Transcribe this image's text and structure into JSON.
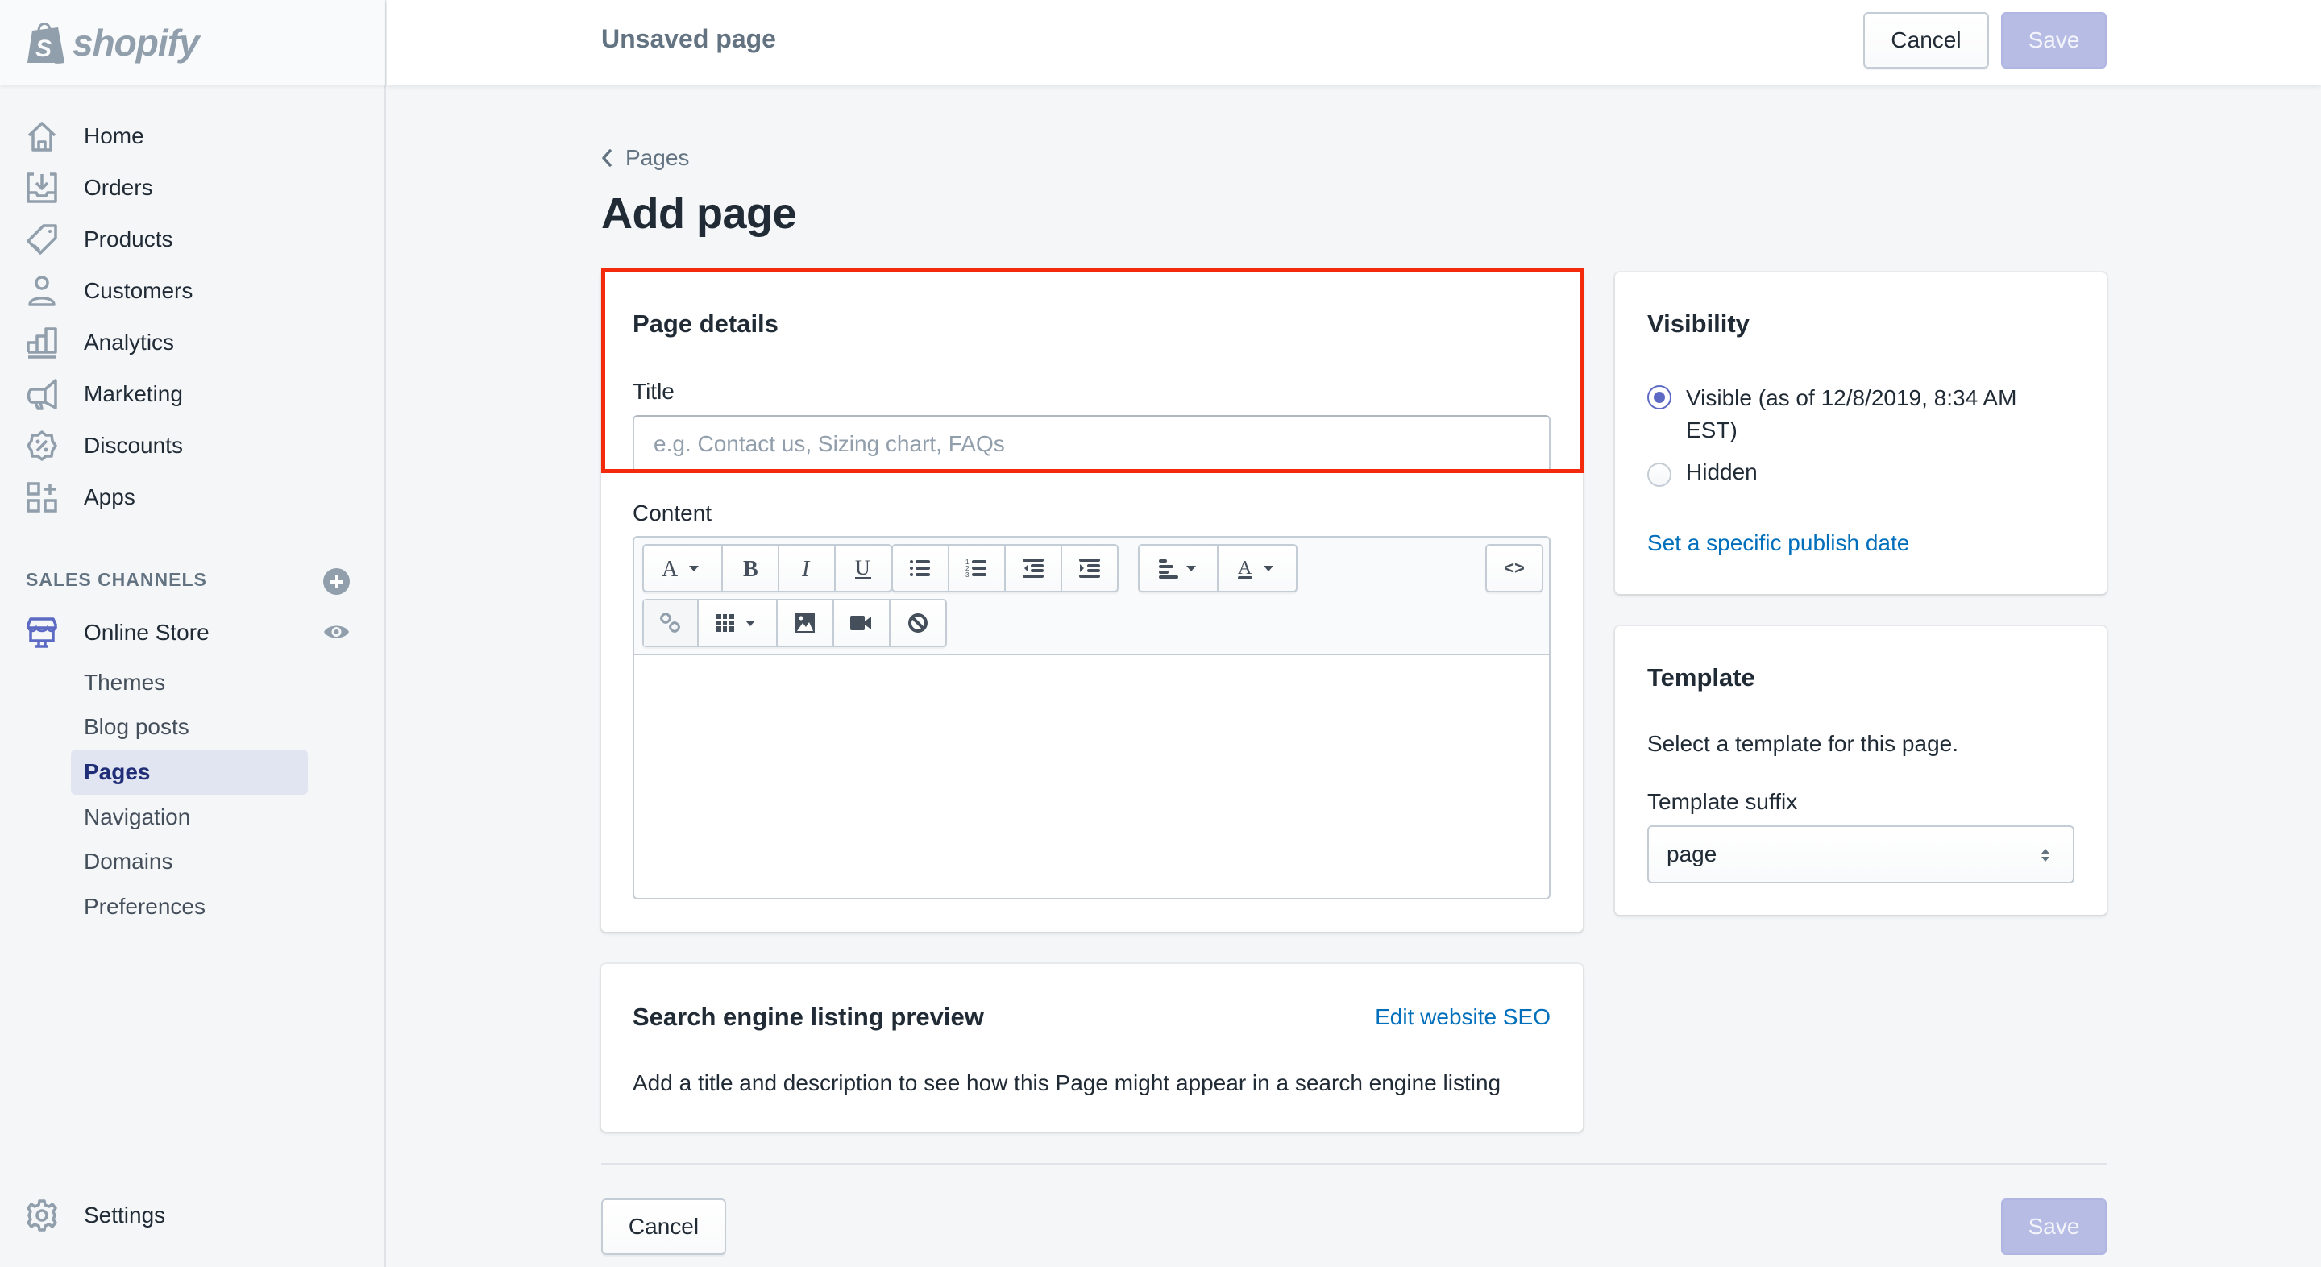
{
  "brand": {
    "name": "shopify"
  },
  "sidebar": {
    "items": [
      {
        "label": "Home",
        "icon": "home-icon"
      },
      {
        "label": "Orders",
        "icon": "orders-icon"
      },
      {
        "label": "Products",
        "icon": "tag-icon"
      },
      {
        "label": "Customers",
        "icon": "person-icon"
      },
      {
        "label": "Analytics",
        "icon": "bar-chart-icon"
      },
      {
        "label": "Marketing",
        "icon": "megaphone-icon"
      },
      {
        "label": "Discounts",
        "icon": "discount-icon"
      },
      {
        "label": "Apps",
        "icon": "apps-icon"
      }
    ],
    "sales_channels_title": "SALES CHANNELS",
    "online_store": {
      "label": "Online Store",
      "sub_items": [
        {
          "label": "Themes",
          "active": false
        },
        {
          "label": "Blog posts",
          "active": false
        },
        {
          "label": "Pages",
          "active": true
        },
        {
          "label": "Navigation",
          "active": false
        },
        {
          "label": "Domains",
          "active": false
        },
        {
          "label": "Preferences",
          "active": false
        }
      ]
    },
    "settings_label": "Settings"
  },
  "topbar": {
    "title": "Unsaved page",
    "cancel_label": "Cancel",
    "save_label": "Save"
  },
  "page": {
    "breadcrumb": "Pages",
    "title": "Add page"
  },
  "page_details": {
    "title": "Page details",
    "title_label": "Title",
    "title_value": "",
    "title_placeholder": "e.g. Contact us, Sizing chart, FAQs",
    "content_label": "Content",
    "toolbar": {
      "row1": [
        "font-format",
        "bold",
        "italic",
        "underline",
        "bulleted-list",
        "numbered-list",
        "outdent",
        "indent",
        "align",
        "text-color"
      ],
      "row2": [
        "link",
        "table",
        "image",
        "video",
        "clear-formatting"
      ],
      "html_toggle": "<>"
    }
  },
  "seo": {
    "title": "Search engine listing preview",
    "edit_link": "Edit website SEO",
    "description": "Add a title and description to see how this Page might appear in a search engine listing"
  },
  "visibility": {
    "title": "Visibility",
    "options": [
      {
        "label": "Visible (as of 12/8/2019, 8:34 AM EST)",
        "checked": true
      },
      {
        "label": "Hidden",
        "checked": false
      }
    ],
    "publish_link": "Set a specific publish date"
  },
  "template": {
    "title": "Template",
    "description": "Select a template for this page.",
    "suffix_label": "Template suffix",
    "suffix_value": "page"
  },
  "footer": {
    "cancel_label": "Cancel",
    "save_label": "Save"
  },
  "colors": {
    "accent": "#5c6ac4",
    "link": "#006fbb",
    "highlight": "#f42a0d",
    "save_disabled": "#b7bce5"
  }
}
